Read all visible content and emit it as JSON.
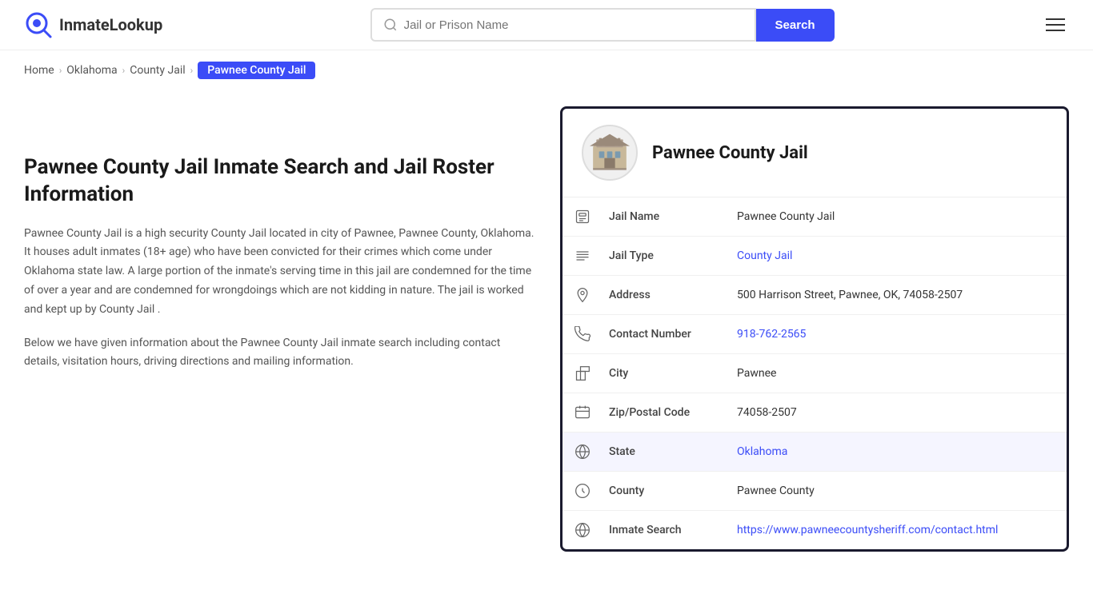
{
  "site": {
    "logo_text_part1": "Inmate",
    "logo_text_part2": "Lookup"
  },
  "header": {
    "search_placeholder": "Jail or Prison Name",
    "search_button_label": "Search"
  },
  "breadcrumb": {
    "items": [
      {
        "label": "Home",
        "href": "#"
      },
      {
        "label": "Oklahoma",
        "href": "#"
      },
      {
        "label": "County Jail",
        "href": "#"
      },
      {
        "label": "Pawnee County Jail",
        "current": true
      }
    ]
  },
  "left": {
    "page_title": "Pawnee County Jail Inmate Search and Jail Roster Information",
    "description1": "Pawnee County Jail is a high security County Jail located in city of Pawnee, Pawnee County, Oklahoma. It houses adult inmates (18+ age) who have been convicted for their crimes which come under Oklahoma state law. A large portion of the inmate's serving time in this jail are condemned for the time of over a year and are condemned for wrongdoings which are not kidding in nature. The jail is worked and kept up by County Jail .",
    "description2": "Below we have given information about the Pawnee County Jail inmate search including contact details, visitation hours, driving directions and mailing information."
  },
  "jail_card": {
    "name": "Pawnee County Jail",
    "rows": [
      {
        "icon": "jail-icon",
        "label": "Jail Name",
        "value": "Pawnee County Jail",
        "link": false,
        "highlighted": false
      },
      {
        "icon": "type-icon",
        "label": "Jail Type",
        "value": "County Jail",
        "link": true,
        "highlighted": false
      },
      {
        "icon": "address-icon",
        "label": "Address",
        "value": "500 Harrison Street, Pawnee, OK, 74058-2507",
        "link": false,
        "highlighted": false
      },
      {
        "icon": "phone-icon",
        "label": "Contact Number",
        "value": "918-762-2565",
        "link": true,
        "highlighted": false
      },
      {
        "icon": "city-icon",
        "label": "City",
        "value": "Pawnee",
        "link": false,
        "highlighted": false
      },
      {
        "icon": "zip-icon",
        "label": "Zip/Postal Code",
        "value": "74058-2507",
        "link": false,
        "highlighted": false
      },
      {
        "icon": "state-icon",
        "label": "State",
        "value": "Oklahoma",
        "link": true,
        "highlighted": true
      },
      {
        "icon": "county-icon",
        "label": "County",
        "value": "Pawnee County",
        "link": false,
        "highlighted": false
      },
      {
        "icon": "search-icon",
        "label": "Inmate Search",
        "value": "https://www.pawneecountysheriff.com/contact.html",
        "link": true,
        "highlighted": false
      }
    ]
  }
}
